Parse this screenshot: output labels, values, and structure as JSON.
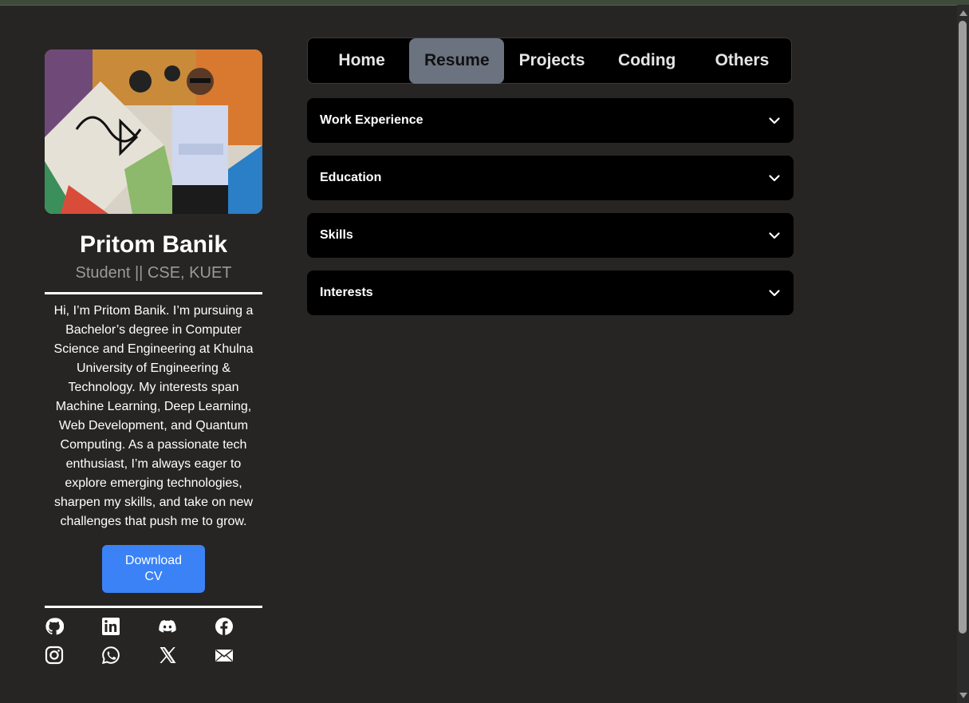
{
  "profile": {
    "name": "Pritom Banik",
    "role": "Student || CSE, KUET",
    "bio": "Hi, I’m Pritom Banik. I’m pursuing a Bachelor’s degree in Computer Science and Engineering at Khulna University of Engineering & Technology. My interests span Machine Learning, Deep Learning, Web Development, and Quantum Computing. As a passionate tech enthusiast, I’m always eager to explore emerging technologies, sharpen my skills, and take on new challenges that push me to grow.",
    "cv_label": "Download CV"
  },
  "socials": [
    {
      "icon": "github-icon"
    },
    {
      "icon": "linkedin-icon"
    },
    {
      "icon": "discord-icon"
    },
    {
      "icon": "facebook-icon"
    },
    {
      "icon": "instagram-icon"
    },
    {
      "icon": "whatsapp-icon"
    },
    {
      "icon": "x-icon"
    },
    {
      "icon": "mail-icon"
    }
  ],
  "nav": {
    "items": [
      {
        "label": "Home"
      },
      {
        "label": "Resume"
      },
      {
        "label": "Projects"
      },
      {
        "label": "Coding"
      },
      {
        "label": "Others"
      }
    ],
    "active": "Resume"
  },
  "accordion": [
    {
      "label": "Work Experience"
    },
    {
      "label": "Education"
    },
    {
      "label": "Skills"
    },
    {
      "label": "Interests"
    }
  ],
  "colors": {
    "page_bg": "#262524",
    "accent": "#3b82f6",
    "active_tab": "#6b7280",
    "panel": "#000000"
  }
}
